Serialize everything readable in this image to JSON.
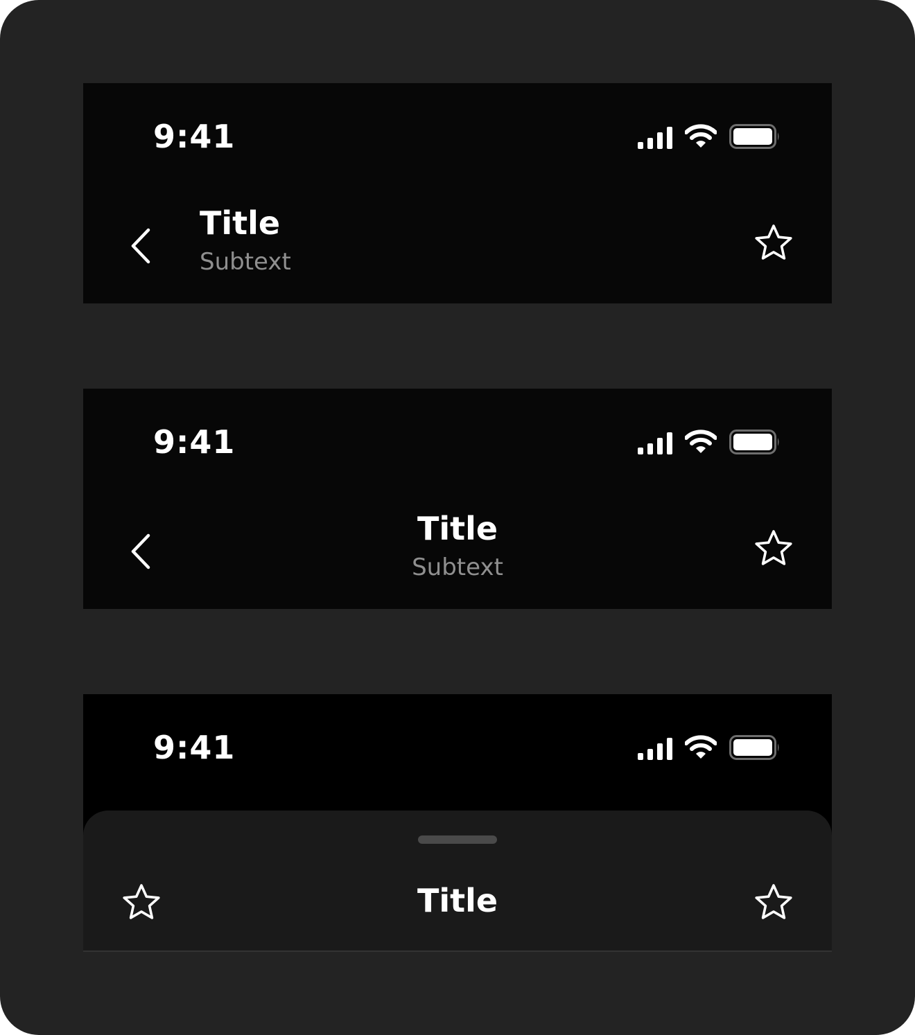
{
  "variants": [
    {
      "status_time": "9:41",
      "nav_title": "Title",
      "nav_subtext": "Subtext",
      "title_alignment": "left",
      "leading_icon": "chevron-left-icon",
      "trailing_icon": "star-icon"
    },
    {
      "status_time": "9:41",
      "nav_title": "Title",
      "nav_subtext": "Subtext",
      "title_alignment": "center",
      "leading_icon": "chevron-left-icon",
      "trailing_icon": "star-icon"
    },
    {
      "status_time": "9:41",
      "nav_title": "Title",
      "title_alignment": "center",
      "style": "bottom-sheet with grabber",
      "leading_icon": "star-icon",
      "trailing_icon": "star-icon"
    }
  ],
  "colors": {
    "frame_background": "#232323",
    "bar_background": "#070707",
    "sheet_background": "#1a1a1a",
    "title_text": "#ffffff",
    "subtext": "#8f8f8f",
    "grabber": "#4a4a4a"
  }
}
